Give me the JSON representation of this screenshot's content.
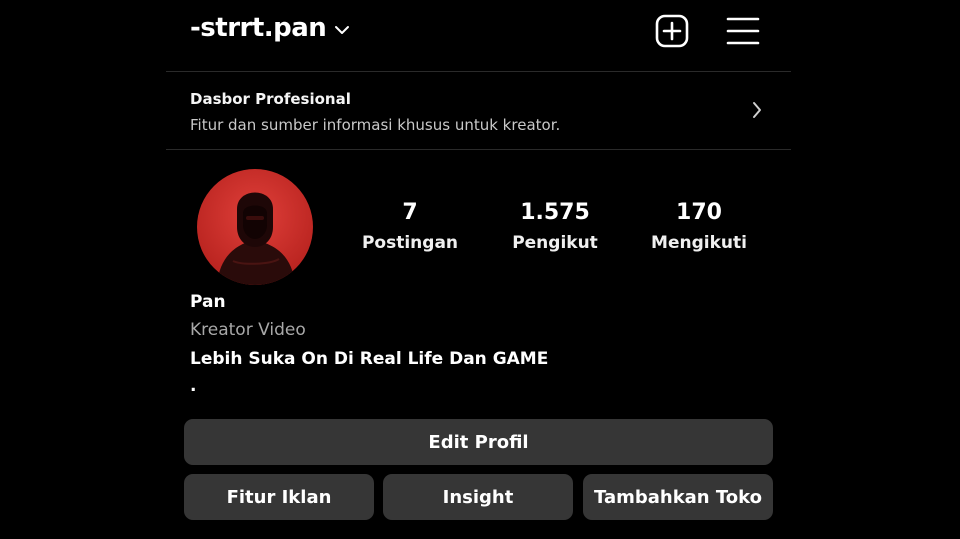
{
  "header": {
    "username": "-strrt.pan",
    "chevron_icon": "chevron-down-icon",
    "add_icon": "plus-square-icon",
    "menu_icon": "hamburger-menu-icon"
  },
  "dashboard": {
    "title": "Dasbor Profesional",
    "subtitle": "Fitur dan sumber informasi khusus untuk kreator.",
    "arrow_icon": "chevron-right-icon"
  },
  "profile": {
    "avatar_accent": "#d6322b",
    "stats": {
      "posts": {
        "value": "7",
        "label": "Postingan"
      },
      "followers": {
        "value": "1.575",
        "label": "Pengikut"
      },
      "following": {
        "value": "170",
        "label": "Mengikuti"
      }
    },
    "name": "Pan",
    "category": "Kreator Video",
    "bio": "Lebih Suka On Di Real Life Dan GAME",
    "bio_extra": "."
  },
  "buttons": {
    "edit_profile": "Edit Profil",
    "ad_tools": "Fitur Iklan",
    "insight": "Insight",
    "add_shop": "Tambahkan Toko"
  },
  "colors": {
    "background": "#000000",
    "button_bg": "#363636",
    "divider": "#2a2a2a",
    "secondary_text": "#a8a8a8"
  }
}
